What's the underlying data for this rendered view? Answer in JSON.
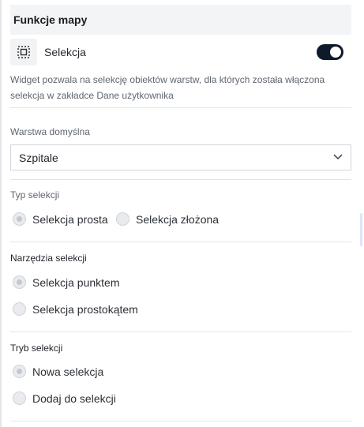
{
  "panel": {
    "title": "Funkcje mapy",
    "selection_label": "Selekcja",
    "selection_enabled": true,
    "description": "Widget pozwala na selekcję obiektów warstw, dla których została włączona selekcja w zakładce Dane użytkownika"
  },
  "default_layer": {
    "label": "Warstwa domyślna",
    "value": "Szpitale"
  },
  "selection_type": {
    "label": "Typ selekcji",
    "options": [
      "Selekcja prosta",
      "Selekcja złożona"
    ],
    "selected": "Selekcja prosta"
  },
  "selection_tools": {
    "label": "Narzędzia selekcji",
    "options": [
      "Selekcja punktem",
      "Selekcja prostokątem"
    ],
    "selected": "Selekcja punktem"
  },
  "selection_mode": {
    "label": "Tryb selekcji",
    "options": [
      "Nowa selekcja",
      "Dodaj do selekcji"
    ],
    "selected": "Nowa selekcja"
  },
  "icons": {
    "selection": "selection-box-icon",
    "dropdown": "chevron-down-icon"
  },
  "colors": {
    "toggle_on": "#0e1a2b",
    "header_bg": "#f3f4f6"
  }
}
